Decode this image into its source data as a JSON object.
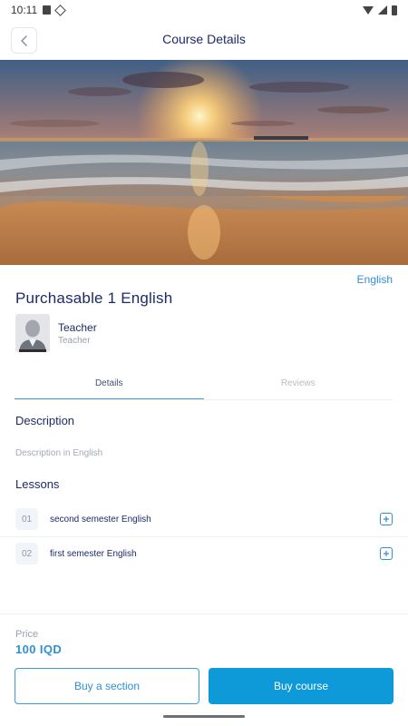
{
  "status_bar": {
    "time": "10:11"
  },
  "header": {
    "title": "Course Details"
  },
  "course": {
    "language_label": "English",
    "title": "Purchasable 1 English"
  },
  "teacher": {
    "name": "Teacher",
    "role": "Teacher"
  },
  "tabs": [
    {
      "label": "Details",
      "active": true
    },
    {
      "label": "Reviews",
      "active": false
    }
  ],
  "description": {
    "heading": "Description",
    "text": "Description in English"
  },
  "lessons": {
    "heading": "Lessons",
    "items": [
      {
        "number": "01",
        "title": "second semester English"
      },
      {
        "number": "02",
        "title": "first semester English"
      }
    ]
  },
  "purchase": {
    "price_label": "Price",
    "price_value": "100 IQD",
    "buy_section_label": "Buy a section",
    "buy_course_label": "Buy course"
  },
  "colors": {
    "accent": "#0e9ad8",
    "title": "#1c2a6b",
    "link": "#2f8fd6"
  },
  "icons": [
    "sim-icon",
    "vpn-icon",
    "wifi-icon",
    "signal-icon",
    "battery-icon",
    "back-arrow-icon",
    "expand-plus-icon"
  ]
}
